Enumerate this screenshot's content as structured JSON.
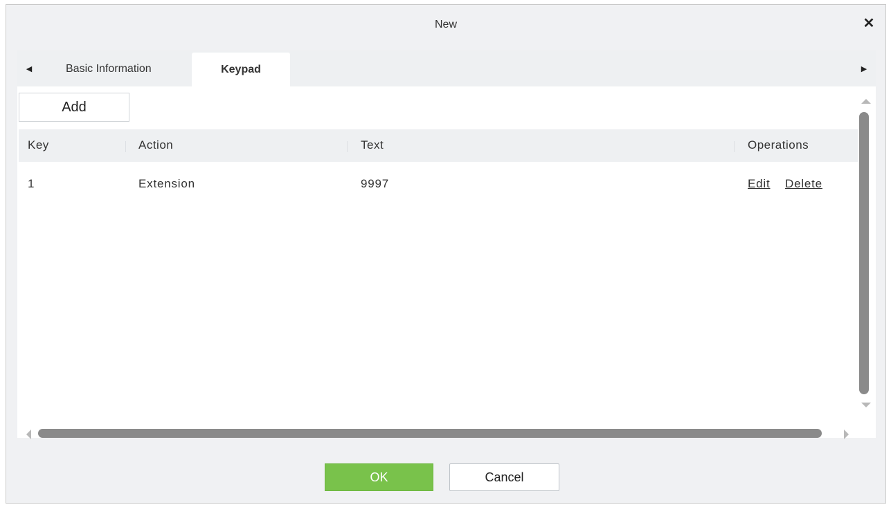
{
  "dialog": {
    "title": "New",
    "close_icon": "close-icon"
  },
  "tabs": {
    "left_arrow_icon": "triangle-left-icon",
    "right_arrow_icon": "triangle-right-icon",
    "items": [
      {
        "label": "Basic Information",
        "active": false
      },
      {
        "label": "Keypad",
        "active": true
      }
    ]
  },
  "toolbar": {
    "add_label": "Add"
  },
  "table": {
    "columns": [
      "Key",
      "Action",
      "Text",
      "Operations"
    ],
    "rows": [
      {
        "key": "1",
        "action": "Extension",
        "text": "9997",
        "edit_label": "Edit",
        "delete_label": "Delete"
      }
    ]
  },
  "footer": {
    "ok_label": "OK",
    "cancel_label": "Cancel"
  },
  "colors": {
    "ok_button": "#79c24b",
    "scrollbar_thumb": "#8a8a8a",
    "header_background": "#eef0f2"
  }
}
